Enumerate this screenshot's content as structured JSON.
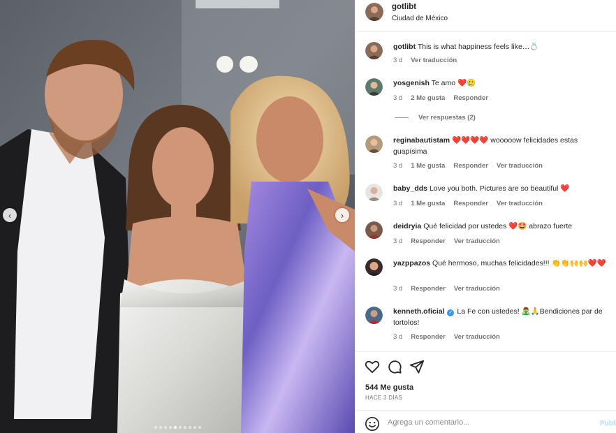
{
  "post": {
    "username": "gotlibt",
    "location": "Ciudad de México",
    "slides_total": 10,
    "slide_active_index": 4,
    "prev_icon": "chevron-left-icon",
    "next_icon": "chevron-right-icon"
  },
  "comments": [
    {
      "user": "gotlibt",
      "text": "This is what happiness feels like…💍",
      "time": "3 d",
      "likes": "",
      "reply": "",
      "translate": "Ver traducción"
    },
    {
      "user": "yosgenish",
      "text": "Te amo ❤️🥲",
      "time": "3 d",
      "likes": "2 Me gusta",
      "reply": "Responder",
      "translate": ""
    },
    {
      "user": "reginabautistam",
      "text": "❤️❤️❤️❤️ wooooow felicidades estas guapísima",
      "time": "3 d",
      "likes": "1 Me gusta",
      "reply": "Responder",
      "translate": "Ver traducción"
    },
    {
      "user": "baby_dds",
      "text": "Love you both. Pictures are so beautiful ❤️",
      "time": "3 d",
      "likes": "1 Me gusta",
      "reply": "Responder",
      "translate": "Ver traducción"
    },
    {
      "user": "deidryia",
      "text": "Qué felicidad por ustedes ❤️🤩 abrazo fuerte",
      "time": "3 d",
      "likes": "",
      "reply": "Responder",
      "translate": "Ver traducción"
    },
    {
      "user": "yazppazos",
      "text": "Qué hermoso, muchas felicidades!!! 👏👏🙌🙌❤️❤️",
      "time": "3 d",
      "likes": "",
      "reply": "Responder",
      "translate": "Ver traducción"
    },
    {
      "user": "kenneth.oficial",
      "verified": true,
      "text": "La Fe con ustedes! 🧟‍♂️🙏Bendiciones par de tortolos!",
      "time": "3 d",
      "likes": "",
      "reply": "Responder",
      "translate": "Ver traducción"
    }
  ],
  "view_replies": "Ver respuestas (2)",
  "actions": {
    "like_icon": "heart-icon",
    "comment_icon": "comment-icon",
    "share_icon": "share-icon",
    "likes_count": "544 Me gusta",
    "posted_ago": "HACE 3 DÍAS"
  },
  "composer": {
    "emoji_icon": "smiley-icon",
    "placeholder": "Agrega un comentario...",
    "publish_label": "Publi"
  },
  "colors": {
    "text": "#262626",
    "secondary": "#737373",
    "heart": "#e0245e",
    "verified": "#3897f0",
    "publish_disabled": "#b3dbff"
  }
}
